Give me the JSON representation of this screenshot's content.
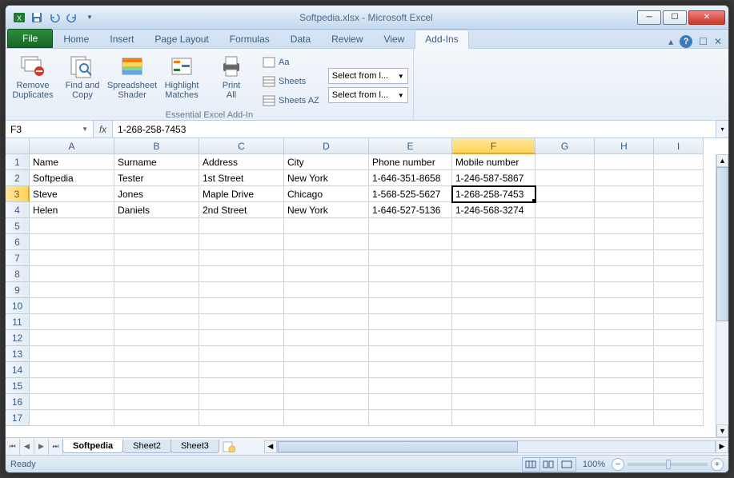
{
  "title": "Softpedia.xlsx - Microsoft Excel",
  "ribbon_tabs": [
    "File",
    "Home",
    "Insert",
    "Page Layout",
    "Formulas",
    "Data",
    "Review",
    "View",
    "Add-Ins"
  ],
  "active_tab": "Add-Ins",
  "ribbon": {
    "remove_dup": "Remove\nDuplicates",
    "find_copy": "Find and\nCopy",
    "shader": "Spreadsheet\nShader",
    "highlight": "Highlight\nMatches",
    "print_all": "Print\nAll",
    "aa": "Aa",
    "sheets": "Sheets",
    "sheets_az": "Sheets AZ",
    "combo_text": "Select from l...",
    "group_label": "Essential Excel Add-In"
  },
  "namebox": "F3",
  "formula": "1-268-258-7453",
  "columns": [
    "A",
    "B",
    "C",
    "D",
    "E",
    "F",
    "G",
    "H",
    "I"
  ],
  "col_widths": [
    "cA",
    "cB",
    "cC",
    "cD",
    "cE",
    "cF",
    "cG",
    "cH",
    "cI"
  ],
  "active_cell": {
    "row": 3,
    "col": 5
  },
  "rows": [
    [
      "Name",
      "Surname",
      "Address",
      "City",
      "Phone number",
      "Mobile number",
      "",
      "",
      ""
    ],
    [
      "Softpedia",
      "Tester",
      "1st Street",
      "New York",
      "1-646-351-8658",
      "1-246-587-5867",
      "",
      "",
      ""
    ],
    [
      "Steve",
      "Jones",
      "Maple Drive",
      "Chicago",
      "1-568-525-5627",
      "1-268-258-7453",
      "",
      "",
      ""
    ],
    [
      "Helen",
      "Daniels",
      "2nd Street",
      "New York",
      "1-646-527-5136",
      "1-246-568-3274",
      "",
      "",
      ""
    ],
    [
      "",
      "",
      "",
      "",
      "",
      "",
      "",
      "",
      ""
    ],
    [
      "",
      "",
      "",
      "",
      "",
      "",
      "",
      "",
      ""
    ],
    [
      "",
      "",
      "",
      "",
      "",
      "",
      "",
      "",
      ""
    ],
    [
      "",
      "",
      "",
      "",
      "",
      "",
      "",
      "",
      ""
    ],
    [
      "",
      "",
      "",
      "",
      "",
      "",
      "",
      "",
      ""
    ],
    [
      "",
      "",
      "",
      "",
      "",
      "",
      "",
      "",
      ""
    ],
    [
      "",
      "",
      "",
      "",
      "",
      "",
      "",
      "",
      ""
    ],
    [
      "",
      "",
      "",
      "",
      "",
      "",
      "",
      "",
      ""
    ],
    [
      "",
      "",
      "",
      "",
      "",
      "",
      "",
      "",
      ""
    ],
    [
      "",
      "",
      "",
      "",
      "",
      "",
      "",
      "",
      ""
    ],
    [
      "",
      "",
      "",
      "",
      "",
      "",
      "",
      "",
      ""
    ],
    [
      "",
      "",
      "",
      "",
      "",
      "",
      "",
      "",
      ""
    ],
    [
      "",
      "",
      "",
      "",
      "",
      "",
      "",
      "",
      ""
    ]
  ],
  "sheets": [
    "Softpedia",
    "Sheet2",
    "Sheet3"
  ],
  "active_sheet": 0,
  "status": "Ready",
  "zoom": "100%"
}
